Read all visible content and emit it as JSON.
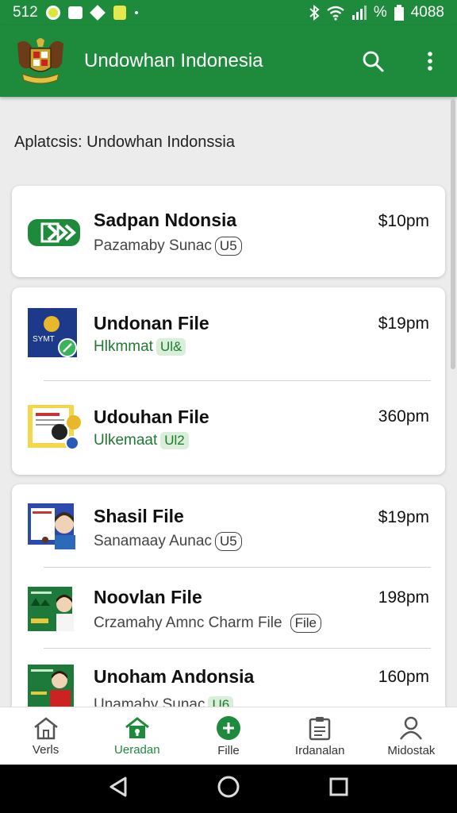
{
  "status": {
    "time": "512",
    "right_text": "%",
    "battery_text": "4088"
  },
  "appbar": {
    "title": "Undowhan Indonesia",
    "search_icon": "search-icon",
    "more_icon": "more-vert-icon"
  },
  "subtitle": "Aplatcsis: Undowhan Indonssia",
  "cards": [
    {
      "rows": [
        {
          "name": "Sadpan Ndonsia",
          "sub": "Pazamaby Sunac",
          "tag": "U5",
          "tag_style": "outline",
          "price": "$10pm"
        }
      ]
    },
    {
      "rows": [
        {
          "name": "Undonan File",
          "sub": "Hlkmmat",
          "tag": "Ul&",
          "tag_style": "green",
          "price": "$19pm"
        },
        {
          "name": "Udouhan File",
          "sub": "Ulkemaat",
          "tag": "Ul2",
          "tag_style": "green",
          "price": "360pm"
        }
      ]
    },
    {
      "rows": [
        {
          "name": "Shasil File",
          "sub": "Sanamaay Aunac",
          "tag": "U5",
          "tag_style": "outline",
          "price": "$19pm"
        },
        {
          "name": "Noovlan File",
          "sub": "Crzamahy Amnc Charm File",
          "tag": "File",
          "tag_style": "outline",
          "price": "198pm"
        },
        {
          "name": "Unoham Andonsia",
          "sub": "Unamahy Sunac",
          "tag": "U6",
          "tag_style": "green",
          "price": "160pm"
        }
      ]
    }
  ],
  "bottom_nav": [
    {
      "label": "Verls",
      "icon": "home-icon",
      "active": false
    },
    {
      "label": "Ueradan",
      "icon": "home-lock-icon",
      "active": true
    },
    {
      "label": "Fille",
      "icon": "add-circle-icon",
      "active": false
    },
    {
      "label": "Irdanalan",
      "icon": "clipboard-icon",
      "active": false
    },
    {
      "label": "Midostak",
      "icon": "person-icon",
      "active": false
    }
  ],
  "colors": {
    "primary": "#1e8a3c",
    "tag_green_bg": "#d9efd9",
    "tag_green_text": "#1f7a30"
  }
}
